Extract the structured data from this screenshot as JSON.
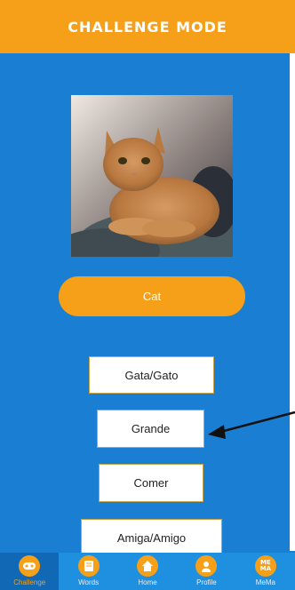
{
  "header": {
    "title": "CHALLENGE MODE"
  },
  "prompt": {
    "answer": "Cat"
  },
  "options": [
    {
      "label": "Gata/Gato"
    },
    {
      "label": "Grande"
    },
    {
      "label": "Comer"
    },
    {
      "label": "Amiga/Amigo"
    }
  ],
  "nav": {
    "items": [
      {
        "label": "Challenge",
        "icon": "gamepad-icon",
        "active": true
      },
      {
        "label": "Words",
        "icon": "book-icon",
        "active": false
      },
      {
        "label": "Home",
        "icon": "home-icon",
        "active": false
      },
      {
        "label": "Profile",
        "icon": "user-icon",
        "active": false
      },
      {
        "label": "MeMa",
        "icon": "mema-logo-icon",
        "badge": "ME MA",
        "active": false
      }
    ]
  },
  "colors": {
    "primary": "#1a7ed3",
    "accent": "#f6a019",
    "nav": "#1f8fe0"
  }
}
